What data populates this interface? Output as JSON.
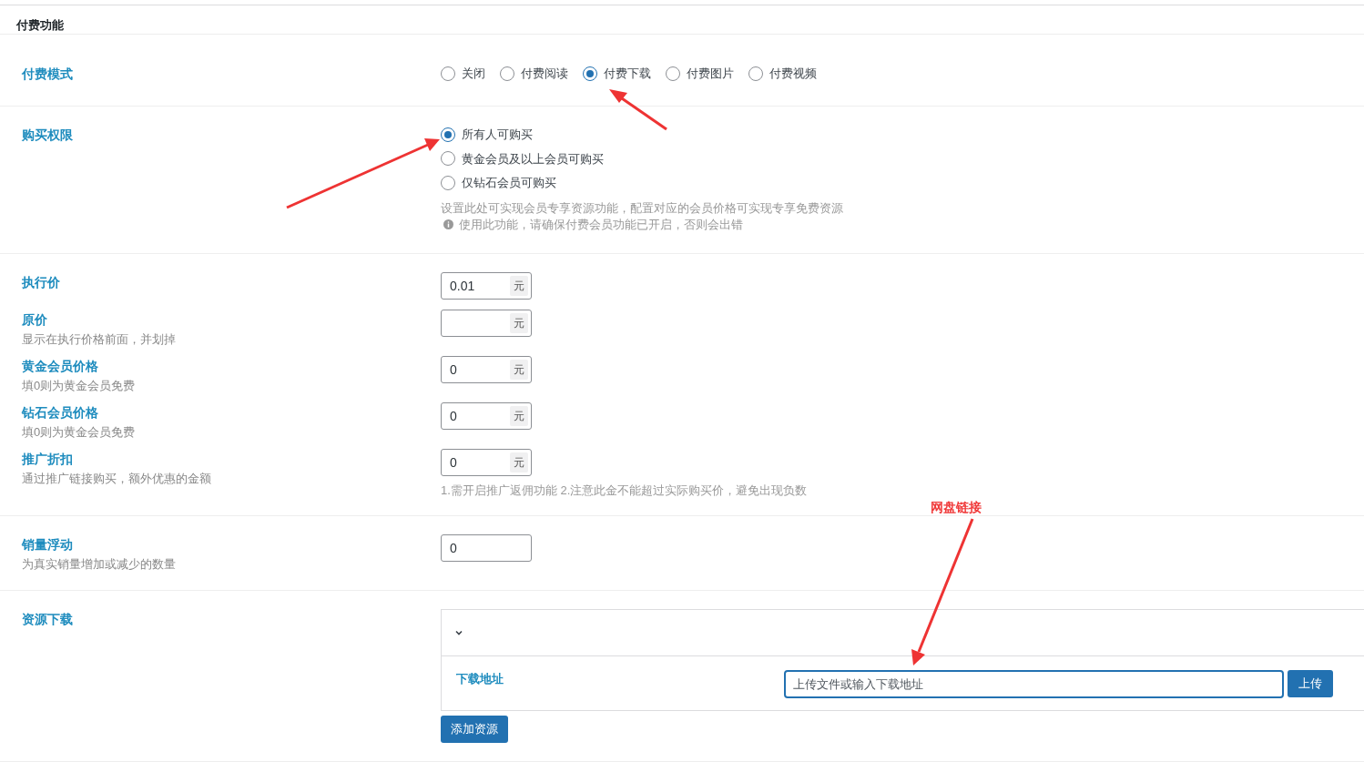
{
  "section_title": "付费功能",
  "pay_mode": {
    "label": "付费模式",
    "options": [
      {
        "label": "关闭",
        "selected": false
      },
      {
        "label": "付费阅读",
        "selected": false
      },
      {
        "label": "付费下载",
        "selected": true
      },
      {
        "label": "付费图片",
        "selected": false
      },
      {
        "label": "付费视频",
        "selected": false
      }
    ]
  },
  "purchase_permission": {
    "label": "购买权限",
    "options": [
      {
        "label": "所有人可购买",
        "selected": true
      },
      {
        "label": "黄金会员及以上会员可购买",
        "selected": false
      },
      {
        "label": "仅钻石会员可购买",
        "selected": false
      }
    ],
    "note": "设置此处可实现会员专享资源功能，配置对应的会员价格可实现专享免费资源",
    "warning": "使用此功能，请确保付费会员功能已开启，否则会出错"
  },
  "price_fields": [
    {
      "label": "执行价",
      "value": "0.01",
      "unit": "元"
    },
    {
      "label": "原价",
      "hint": "显示在执行价格前面，并划掉",
      "unit": "元"
    },
    {
      "label": "黄金会员价格",
      "hint": "填0则为黄金会员免费",
      "value": "0",
      "unit": "元"
    },
    {
      "label": "钻石会员价格",
      "hint": "填0则为黄金会员免费",
      "value": "0",
      "unit": "元"
    },
    {
      "label": "推广折扣",
      "hint": "通过推广链接购买，额外优惠的金额",
      "value": "0",
      "unit": "元"
    }
  ],
  "price_note": "1.需开启推广返佣功能 2.注意此金不能超过实际购买价，避免出现负数",
  "sales_float": {
    "label": "销量浮动",
    "hint": "为真实销量增加或减少的数量",
    "value": "0"
  },
  "resource_download": {
    "label": "资源下载",
    "items": [
      {
        "expanded": true,
        "field_label": "下载地址",
        "placeholder": "上传文件或输入下载地址",
        "upload_button": "上传"
      }
    ],
    "add_button": "添加资源"
  },
  "annotation": {
    "text": "网盘链接"
  }
}
